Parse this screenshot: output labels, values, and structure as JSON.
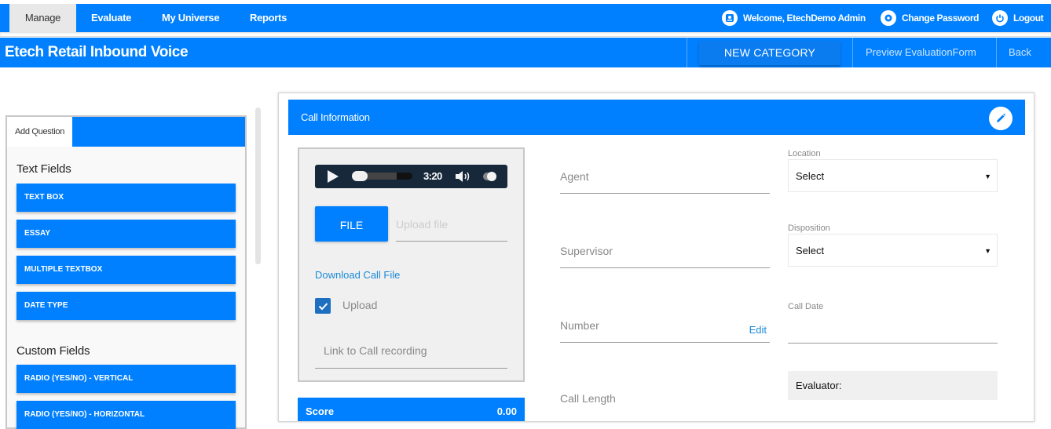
{
  "topnav": {
    "tabs": [
      {
        "label": "Manage",
        "active": true
      },
      {
        "label": "Evaluate",
        "active": false
      },
      {
        "label": "My Universe",
        "active": false
      },
      {
        "label": "Reports",
        "active": false
      }
    ],
    "welcome": "Welcome, EtechDemo Admin",
    "change_password": "Change Password",
    "logout": "Logout"
  },
  "titlebar": {
    "title": "Etech Retail Inbound Voice",
    "new_category": "NEW CATEGORY",
    "preview": "Preview EvaluationForm",
    "back": "Back"
  },
  "sidebar": {
    "tab_label": "Add Question",
    "sections": [
      {
        "heading": "Text Fields",
        "items": [
          "TEXT BOX",
          "ESSAY",
          "MULTIPLE TEXTBOX",
          "DATE TYPE"
        ]
      },
      {
        "heading": "Custom Fields",
        "items": [
          "RADIO (YES/NO) - VERTICAL",
          "RADIO (YES/NO) - HORIZONTAL"
        ]
      }
    ]
  },
  "card": {
    "title": "Call Information",
    "player": {
      "time": "3:20",
      "progress": 0.05
    },
    "file_button": "FILE",
    "upload_placeholder": "Upload file",
    "download_link": "Download Call File",
    "upload_checkbox": {
      "label": "Upload",
      "checked": true
    },
    "link_placeholder": "Link to Call recording",
    "score": {
      "label": "Score",
      "value": "0.00"
    },
    "fields": {
      "agent": "Agent",
      "supervisor": "Supervisor",
      "number": "Number",
      "number_edit": "Edit",
      "call_length": "Call Length"
    },
    "location": {
      "label": "Location",
      "value": "Select"
    },
    "disposition": {
      "label": "Disposition",
      "value": "Select"
    },
    "call_date": {
      "label": "Call Date"
    },
    "evaluator": "Evaluator:"
  },
  "colors": {
    "primary": "#0080ff",
    "player_bg": "#17283a",
    "link": "#1a8ad8"
  }
}
